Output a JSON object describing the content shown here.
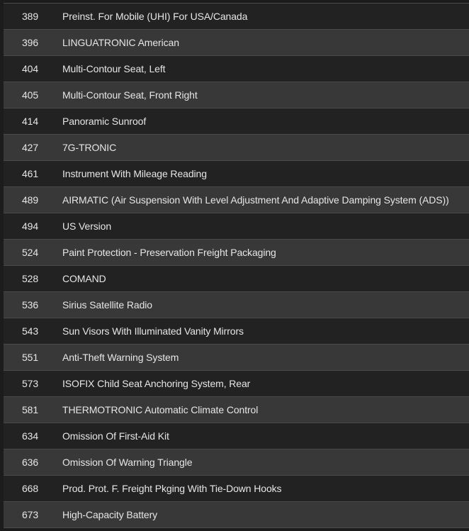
{
  "options": [
    {
      "code": "389",
      "description": "Preinst. For Mobile (UHI) For USA/Canada"
    },
    {
      "code": "396",
      "description": "LINGUATRONIC American"
    },
    {
      "code": "404",
      "description": "Multi-Contour Seat, Left"
    },
    {
      "code": "405",
      "description": "Multi-Contour Seat, Front Right"
    },
    {
      "code": "414",
      "description": "Panoramic Sunroof"
    },
    {
      "code": "427",
      "description": "7G-TRONIC"
    },
    {
      "code": "461",
      "description": "Instrument With Mileage Reading"
    },
    {
      "code": "489",
      "description": "AIRMATIC (Air Suspension With Level Adjustment And Adaptive Damping System (ADS))"
    },
    {
      "code": "494",
      "description": "US Version"
    },
    {
      "code": "524",
      "description": "Paint Protection - Preservation Freight Packaging"
    },
    {
      "code": "528",
      "description": "COMAND"
    },
    {
      "code": "536",
      "description": "Sirius Satellite Radio"
    },
    {
      "code": "543",
      "description": "Sun Visors With Illuminated Vanity Mirrors"
    },
    {
      "code": "551",
      "description": "Anti-Theft Warning System"
    },
    {
      "code": "573",
      "description": "ISOFIX Child Seat Anchoring System, Rear"
    },
    {
      "code": "581",
      "description": "THERMOTRONIC Automatic Climate Control"
    },
    {
      "code": "634",
      "description": "Omission Of First-Aid Kit"
    },
    {
      "code": "636",
      "description": "Omission Of Warning Triangle"
    },
    {
      "code": "668",
      "description": "Prod. Prot. F. Freight Pkging With Tie-Down Hooks"
    },
    {
      "code": "673",
      "description": "High-Capacity Battery"
    }
  ]
}
